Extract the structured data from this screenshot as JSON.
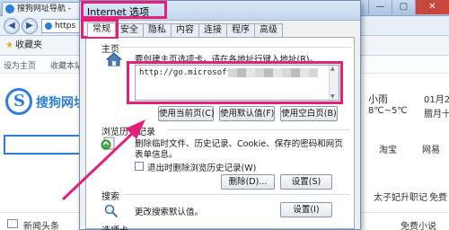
{
  "browser": {
    "tab_title": "搜狗网址导航 -",
    "window_buttons": {
      "minimize": "—",
      "maximize": "▢",
      "close": "✕"
    },
    "nav_back": "◀",
    "nav_forward": "▶",
    "address_text": "https",
    "favorites_label": "收藏夹",
    "fav_items": [
      "",
      "",
      ""
    ],
    "links_left": "设为主页",
    "links_mid": "收藏本站",
    "logo_text": "搜狗网址导",
    "weather_text": "小雨",
    "weather_temp": "8℃~5℃",
    "date_text": "01月2",
    "lunar_text": "腊月十",
    "nav_link_1": "淘宝",
    "nav_link_2": "网易",
    "side_link_1": "太子妃升职记",
    "side_link_2": "免费",
    "news_label": "新闻头条",
    "news_right": "免费小说"
  },
  "dialog": {
    "title": "Internet 选项",
    "tabs": [
      "常规",
      "安全",
      "隐私",
      "内容",
      "连接",
      "程序",
      "高级"
    ],
    "active_tab": "常规",
    "homepage": {
      "group_label": "主页",
      "description": "要创建主页选项卡，请在各地址行键入地址(R)。",
      "url": "http://go.microsoft.",
      "btn_current": "使用当前页(C)",
      "btn_default": "使用默认值(F)",
      "btn_blank": "使用空白页(B)"
    },
    "history": {
      "group_label": "浏览历史记录",
      "description_line1": "删除临时文件、历史记录、Cookie、保存的密码和网页",
      "description_line2": "表单信息。",
      "checkbox_label": "退出时删除浏览历史记录(W)",
      "btn_delete": "删除(D)...",
      "btn_settings": "设置(S)"
    },
    "search": {
      "group_label": "搜索",
      "description": "更改搜索默认值。",
      "btn_settings": "设置(I)"
    },
    "tabs_group_label": "选项卡"
  },
  "colors": {
    "highlight": "#e4217a",
    "accent": "#2b7fd9"
  }
}
